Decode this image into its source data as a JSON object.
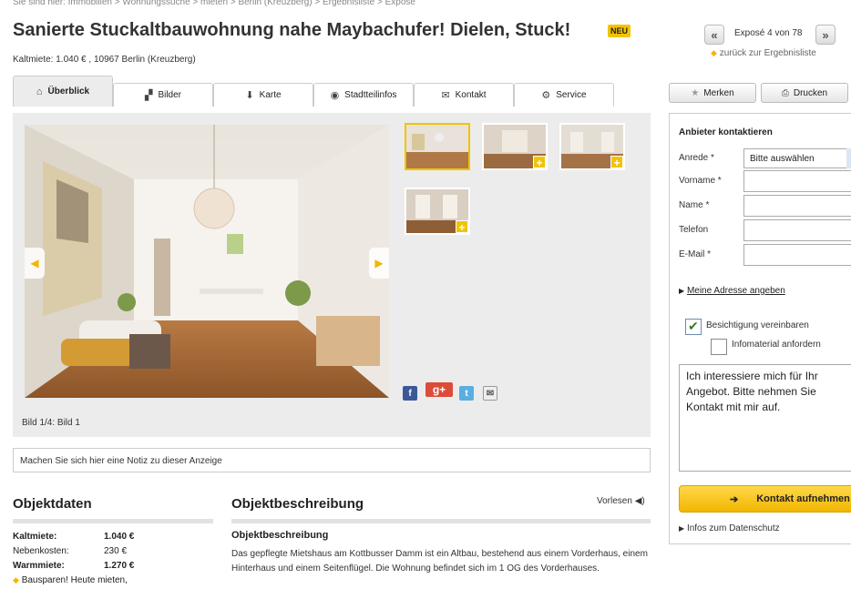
{
  "breadcrumb": "Sie sind hier: Immobilien > Wohnungssuche > mieten > Berlin (Kreuzberg) > Ergebnisliste > Exposé",
  "title": "Sanierte Stuckaltbauwohnung nahe Maybachufer! Dielen, Stuck!",
  "badge": "NEU",
  "subline": "Kaltmiete: 1.040 € , 10967 Berlin (Kreuzberg)",
  "nav": {
    "prev": "«",
    "next": "»",
    "counter": "Exposé 4 von 78",
    "back": "zurück zur Ergebnisliste"
  },
  "tabs": [
    {
      "label": "Überblick",
      "icon": "home-icon",
      "glyph": "⌂"
    },
    {
      "label": "Bilder",
      "icon": "images-icon",
      "glyph": "▞"
    },
    {
      "label": "Karte",
      "icon": "pin-icon",
      "glyph": "⬇"
    },
    {
      "label": "Stadtteilinfos",
      "icon": "target-icon",
      "glyph": "◉"
    },
    {
      "label": "Kontakt",
      "icon": "envelope-icon",
      "glyph": "✉"
    },
    {
      "label": "Service",
      "icon": "gears-icon",
      "glyph": "⚙"
    }
  ],
  "actions": {
    "merken": "Merken",
    "drucken": "Drucken"
  },
  "gallery": {
    "caption": "Bild 1/4: Bild 1"
  },
  "note_placeholder": "Machen Sie sich hier eine Notiz zu dieser Anzeige",
  "objektdaten": {
    "heading": "Objektdaten",
    "rows": [
      {
        "label": "Kaltmiete:",
        "value": "1.040 €"
      },
      {
        "label": "Nebenkosten:",
        "value": "230 €"
      },
      {
        "label": "Warmmiete:",
        "value": "1.270 €"
      }
    ],
    "bauspar": "Bausparen! Heute mieten,"
  },
  "beschreibung": {
    "heading": "Objektbeschreibung",
    "vorlesen": "Vorlesen",
    "sub": "Objektbeschreibung",
    "text": "Das gepflegte Mietshaus am Kottbusser Damm ist ein Altbau, bestehend aus einem Vorderhaus, einem Hinterhaus und einem Seitenflügel. Die Wohnung befindet sich im 1 OG des Vorderhauses."
  },
  "contact": {
    "title": "Anbieter kontaktieren",
    "anrede_label": "Anrede *",
    "anrede_value": "Bitte auswählen",
    "vorname_label": "Vorname *",
    "name_label": "Name *",
    "telefon_label": "Telefon",
    "email_label": "E-Mail *",
    "address_link": "Meine Adresse angeben",
    "besichtigung": "Besichtigung vereinbaren",
    "infomaterial": "Infomaterial anfordern",
    "message": "Ich interessiere mich für Ihr Angebot. Bitte nehmen Sie Kontakt mit mir auf.",
    "submit": "Kontakt aufnehmen",
    "privacy": "Infos zum Datenschutz"
  },
  "colors": {
    "accent": "#f2c300",
    "panel": "#ececec"
  }
}
